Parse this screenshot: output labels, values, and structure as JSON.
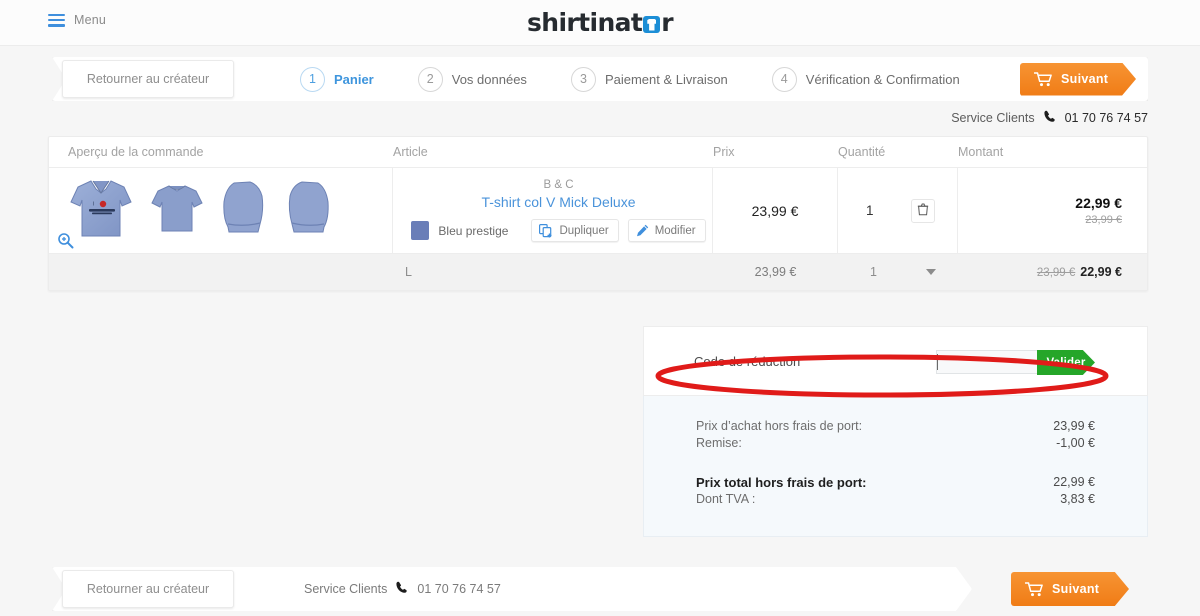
{
  "header": {
    "menu_label": "Menu",
    "logo_text_pre": "shirtinat",
    "logo_text_post": "r",
    "logo_icon": "shirt-icon"
  },
  "steps_bar": {
    "back_label": "Retourner au créateur",
    "steps": [
      {
        "num": "1",
        "label": "Panier",
        "active": true
      },
      {
        "num": "2",
        "label": "Vos données",
        "active": false
      },
      {
        "num": "3",
        "label": "Paiement & Livraison",
        "active": false
      },
      {
        "num": "4",
        "label": "Vérification & Confirmation",
        "active": false
      }
    ],
    "next_label": "Suivant",
    "next_icon": "cart-icon"
  },
  "service": {
    "label": "Service Clients",
    "phone": "01 70 76 74 57",
    "phone_icon": "phone-icon"
  },
  "cart": {
    "columns": {
      "preview": "Aperçu de la commande",
      "article": "Article",
      "price": "Prix",
      "quantity": "Quantité",
      "amount": "Montant"
    },
    "item": {
      "brand": "B & C",
      "name": "T-shirt col V Mick Deluxe",
      "color_name": "Bleu prestige",
      "color_hex": "#6a7eb8",
      "duplicate_label": "Dupliquer",
      "duplicate_icon": "duplicate-icon",
      "modify_label": "Modifier",
      "modify_icon": "pencil-icon",
      "price": "23,99 €",
      "quantity": "1",
      "delete_icon": "trash-icon",
      "zoom_icon": "zoom-in-icon",
      "amount": "22,99 €",
      "amount_old": "23,99 €"
    },
    "variant": {
      "size": "L",
      "price": "23,99 €",
      "quantity": "1",
      "amount_old": "23,99 €",
      "amount_new": "22,99 €",
      "caret_icon": "chevron-down-icon"
    }
  },
  "summary": {
    "coupon_label": "Code de réduction",
    "coupon_value": "",
    "coupon_placeholder": "",
    "validate_label": "Valider",
    "lines": [
      {
        "label": "Prix d’achat hors frais de port:",
        "value": "23,99 €"
      },
      {
        "label": "Remise:",
        "value": "-1,00 €"
      }
    ],
    "total_label": "Prix total hors frais de port:",
    "total_value": "22,99 €",
    "tva_label": "Dont TVA :",
    "tva_value": "3,83 €"
  },
  "annotation": {
    "shape": "red-ellipse-highlight",
    "color": "#e01b19"
  },
  "footer": {
    "back_label": "Retourner au créateur",
    "service_label": "Service Clients",
    "phone": "01 70 76 74 57",
    "phone_icon": "phone-icon",
    "next_label": "Suivant",
    "next_icon": "cart-icon"
  }
}
